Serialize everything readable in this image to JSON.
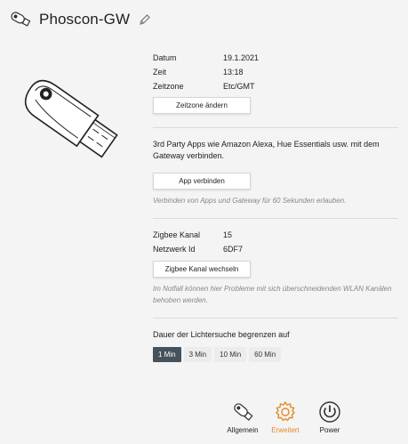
{
  "header": {
    "title": "Phoscon-GW"
  },
  "info": {
    "rows": [
      {
        "label": "Datum",
        "value": "19.1.2021"
      },
      {
        "label": "Zeit",
        "value": "13:18"
      },
      {
        "label": "Zeitzone",
        "value": "Etc/GMT"
      }
    ],
    "timezone_button": "Zeitzone ändern"
  },
  "apps": {
    "description": "3rd Party Apps wie Amazon Alexa, Hue Essentials usw. mit dem Gateway verbinden.",
    "connect_button": "App verbinden",
    "hint": "Verbinden von Apps und Gateway für 60 Sekunden erlauben."
  },
  "zigbee": {
    "rows": [
      {
        "label": "Zigbee Kanal",
        "value": "15"
      },
      {
        "label": "Netzwerk Id",
        "value": "6DF7"
      }
    ],
    "change_button": "Zigbee Kanal wechseln",
    "hint": "Im Notfall können hier Probleme mit sich überschneidenden WLAN Kanälen behoben werden."
  },
  "light_search": {
    "label": "Dauer der Lichtersuche begrenzen auf",
    "options": [
      "1 Min",
      "3 Min",
      "10 Min",
      "60 Min"
    ],
    "selected": "1 Min"
  },
  "nav": {
    "items": [
      {
        "label": "Allgemein",
        "icon": "usb-stick-icon"
      },
      {
        "label": "Erweitert",
        "icon": "gear-icon"
      },
      {
        "label": "Power",
        "icon": "power-icon"
      }
    ],
    "active": "Erweitert"
  },
  "colors": {
    "accent": "#e68a22",
    "selected": "#46525b",
    "background": "#f4f4f4"
  }
}
